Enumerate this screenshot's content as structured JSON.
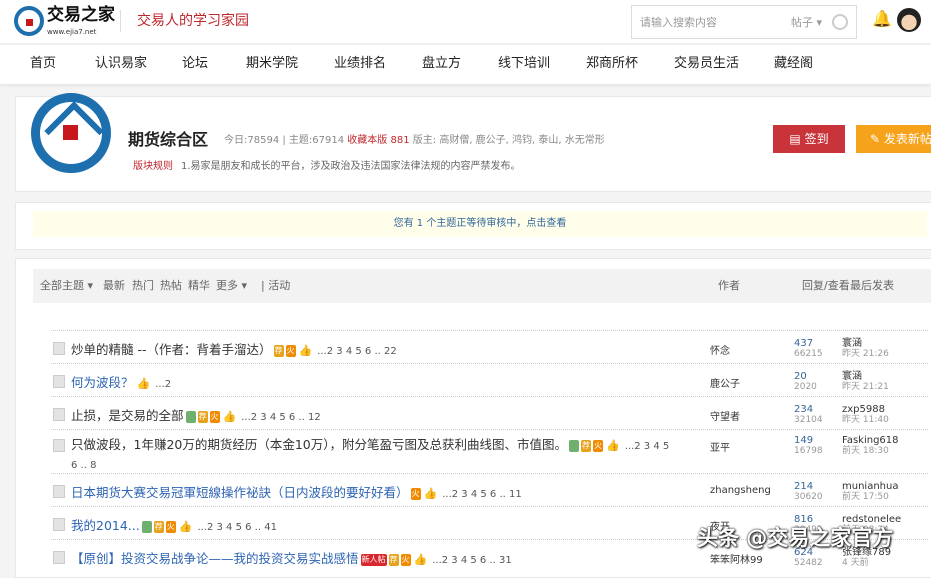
{
  "header": {
    "logo_name": "交易之家",
    "logo_url_text": "www.ejia7.net",
    "slogan": "交易人的学习家园",
    "search_placeholder": "请输入搜索内容",
    "search_type": "帖子 ▾"
  },
  "nav": [
    "首页",
    "认识易家",
    "论坛",
    "期米学院",
    "业绩排名",
    "盘立方",
    "线下培训",
    "郑商所杯",
    "交易员生活",
    "藏经阁"
  ],
  "forum": {
    "title": "期货综合区",
    "today": "今日:78594",
    "topics": "| 主题:67914",
    "fav": "收藏本版",
    "fav_count": "881",
    "moderators": "版主: 高财僧, 鹿公子, 鸿钧, 泰山, 水无常形",
    "rules_label": "版块规则",
    "rules_text": "1.易家是朋友和成长的平台，涉及政治及违法国家法律法规的内容严禁发布。",
    "sign": "签到",
    "post": "发表新帖"
  },
  "notice": "您有 1 个主题正等待审核中，点击查看",
  "toolbar": {
    "all": "全部主题 ▾",
    "latest": "最新",
    "hot": "热门",
    "hotpost": "热帖",
    "digest": "精华",
    "more": "更多 ▾",
    "activity": "| 活动",
    "author": "作者",
    "reply_view": "回复/查看",
    "last_post": "最后发表"
  },
  "tags": {
    "rec": "荐",
    "fire": "火",
    "thumb": "👍",
    "newbie": "新人帖"
  },
  "threads": [
    {
      "title": "炒单的精髓 --（作者：背着手溜达）",
      "pages": "...2 3 4 5 6 .. 22",
      "author": "怀念",
      "replies": "437",
      "views": "66215",
      "last_user": "寰涵",
      "last_time": "昨天 21:26"
    },
    {
      "title": "何为波段？",
      "pages": "...2",
      "author": "鹿公子",
      "replies": "20",
      "views": "2020",
      "last_user": "寰涵",
      "last_time": "昨天 21:21"
    },
    {
      "title": "止损，是交易的全部",
      "pages": "...2 3 4 5 6 .. 12",
      "author": "守望者",
      "replies": "234",
      "views": "32104",
      "last_user": "zxp5988",
      "last_time": "昨天 11:40"
    },
    {
      "title": "只做波段，1年赚20万的期货经历（本金10万），附分笔盈亏图及总获利曲线图、市值图。",
      "pages": "...2 3 4 5 6 .. 8",
      "author": "亚平",
      "replies": "149",
      "views": "16798",
      "last_user": "Fasking618",
      "last_time": "前天 18:30"
    },
    {
      "title": "日本期货大赛交易冠軍短線操作祕訣（日内波段的要好好看）",
      "pages": "...2 3 4 5 6 .. 11",
      "author": "zhangsheng",
      "replies": "214",
      "views": "30620",
      "last_user": "munianhua",
      "last_time": "前天 17:50"
    },
    {
      "title": "我的2014...",
      "pages": "...2 3 4 5 6 .. 41",
      "author": "夜开",
      "replies": "816",
      "views": "30491",
      "last_user": "redstonelee",
      "last_time": "前天 08:24"
    },
    {
      "title": "【原创】投资交易战争论——我的投资交易实战感悟",
      "pages": "...2 3 4 5 6 .. 31",
      "author": "笨笨阿林99",
      "replies": "624",
      "views": "52482",
      "last_user": "张锋缘789",
      "last_time": "4 天前"
    }
  ],
  "watermark": "头条 @交易之家官方"
}
